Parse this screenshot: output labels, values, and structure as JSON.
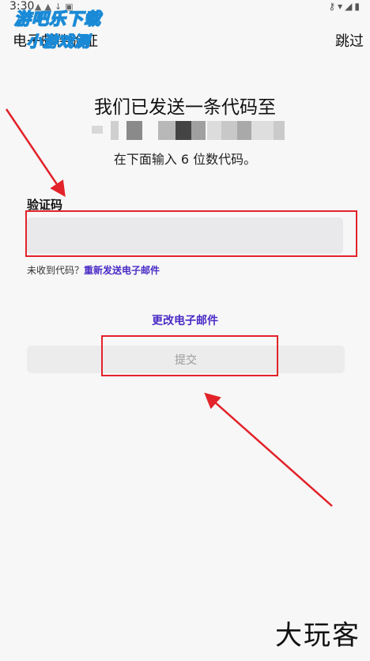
{
  "status_bar": {
    "time": "3:30",
    "icons": [
      "cat-icon",
      "cat-icon",
      "download-icon",
      "a-icon"
    ],
    "right_icons": [
      "key-icon",
      "wifi-icon",
      "signal-icon",
      "battery-icon"
    ]
  },
  "header": {
    "title": "电子邮件验证",
    "skip_label": "跳过"
  },
  "watermark_logo": {
    "line1": "游吧乐下载",
    "line2": "小游戏测"
  },
  "main": {
    "headline": "我们已发送一条代码至",
    "subline": "在下面输入 6 位数代码。",
    "field_label": "验证码",
    "code_value": "",
    "code_placeholder": "",
    "hint_prefix": "未收到代码？",
    "resend_link": "重新发送电子邮件",
    "change_email": "更改电子邮件",
    "submit_label": "提交"
  },
  "colors": {
    "accent": "#4a2bc6",
    "annotation": "#e2232a",
    "input_bg": "#e9e9eb",
    "button_bg": "#ececec"
  },
  "watermark_bottom": "大玩客"
}
